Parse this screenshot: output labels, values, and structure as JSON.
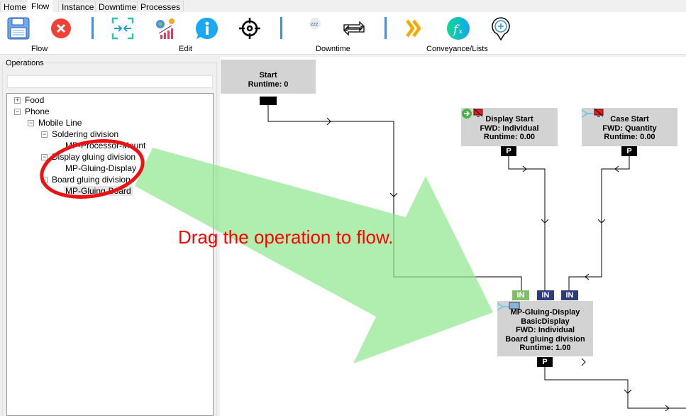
{
  "tabs": [
    {
      "label": "Home"
    },
    {
      "label": "Flow",
      "active": true
    },
    {
      "label": "Instance"
    },
    {
      "label": "Downtime"
    },
    {
      "label": "Processes"
    }
  ],
  "toolbar": {
    "groups": [
      {
        "label": "Flow"
      },
      {
        "label": "Edit"
      },
      {
        "label": "Downtime"
      },
      {
        "label": "Conveyance/Lists"
      }
    ],
    "icons": [
      "save-icon",
      "cancel-icon",
      "collapse-icon",
      "settings-chart-icon",
      "info-icon",
      "target-icon",
      "sleep-moon-icon",
      "repeat-icon",
      "forward-chevrons-icon",
      "function-icon",
      "add-location-icon"
    ]
  },
  "operations": {
    "title": "Operations",
    "search_value": "",
    "tree": [
      {
        "label": "Food",
        "expanded": false
      },
      {
        "label": "Phone",
        "expanded": true
      },
      {
        "label": "Mobile Line",
        "expanded": true
      },
      {
        "label": "Soldering division",
        "expanded": true
      },
      {
        "label": "MP-Processor-Mount"
      },
      {
        "label": "Display gluing division",
        "expanded": true
      },
      {
        "label": "MP-Gluing-Display"
      },
      {
        "label": "Board gluing division",
        "expanded": true
      },
      {
        "label": "MP-Gluing-Board",
        "selected": true
      }
    ]
  },
  "flow": {
    "start": {
      "title": "Start",
      "runtime": "Runtime: 0"
    },
    "display_start": {
      "title": "Display Start",
      "fwd": "FWD: Individual",
      "runtime": "Runtime: 0.00",
      "port": "P"
    },
    "case_start": {
      "title": "Case Start",
      "fwd": "FWD: Quantity",
      "runtime": "Runtime: 0.00",
      "port": "P"
    },
    "main": {
      "title": "MP-Gluing-Display",
      "type": "BasicDisplay",
      "fwd": "FWD: Individual",
      "division": "Board gluing division",
      "runtime": "Runtime: 1.00",
      "inputs": [
        "IN",
        "IN",
        "IN"
      ],
      "port": "P"
    },
    "colors": {
      "in_green": "#7fbf6a",
      "in_blue": "#2e3a7a",
      "node": "#d3d3d3"
    }
  },
  "annotation": {
    "text": "Drag the operation to flow.",
    "color": "#ff0000",
    "arrow_color": "#90e890"
  }
}
